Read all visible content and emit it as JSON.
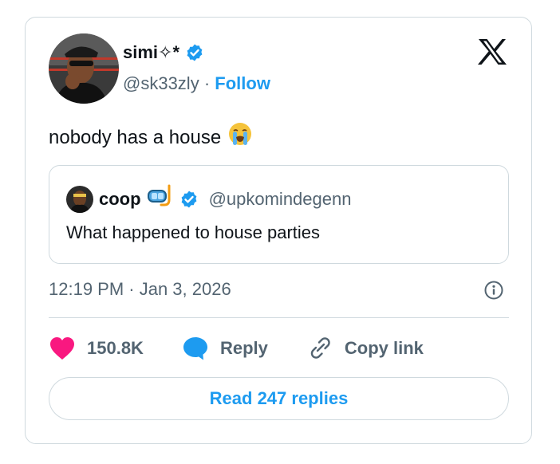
{
  "author": {
    "name": "simi✧*",
    "handle": "@sk33zly",
    "separator": "·",
    "follow_label": "Follow"
  },
  "tweet": {
    "text": "nobody has a house",
    "emoji": "😭"
  },
  "quoted": {
    "name": "coop",
    "emoji": "🤿",
    "handle": "@upkomindegenn",
    "text": "What happened to house parties"
  },
  "meta": {
    "timestamp": "12:19 PM · Jan 3, 2026"
  },
  "actions": {
    "likes": "150.8K",
    "reply_label": "Reply",
    "copy_link_label": "Copy link"
  },
  "read_replies_label": "Read 247 replies",
  "colors": {
    "accent": "#1d9bf0",
    "like": "#f91880",
    "muted_text": "#536471",
    "border": "#cfd9de"
  },
  "icons": [
    "verified-badge-icon",
    "x-logo-icon",
    "info-icon",
    "heart-icon",
    "reply-bubble-icon",
    "link-icon"
  ]
}
